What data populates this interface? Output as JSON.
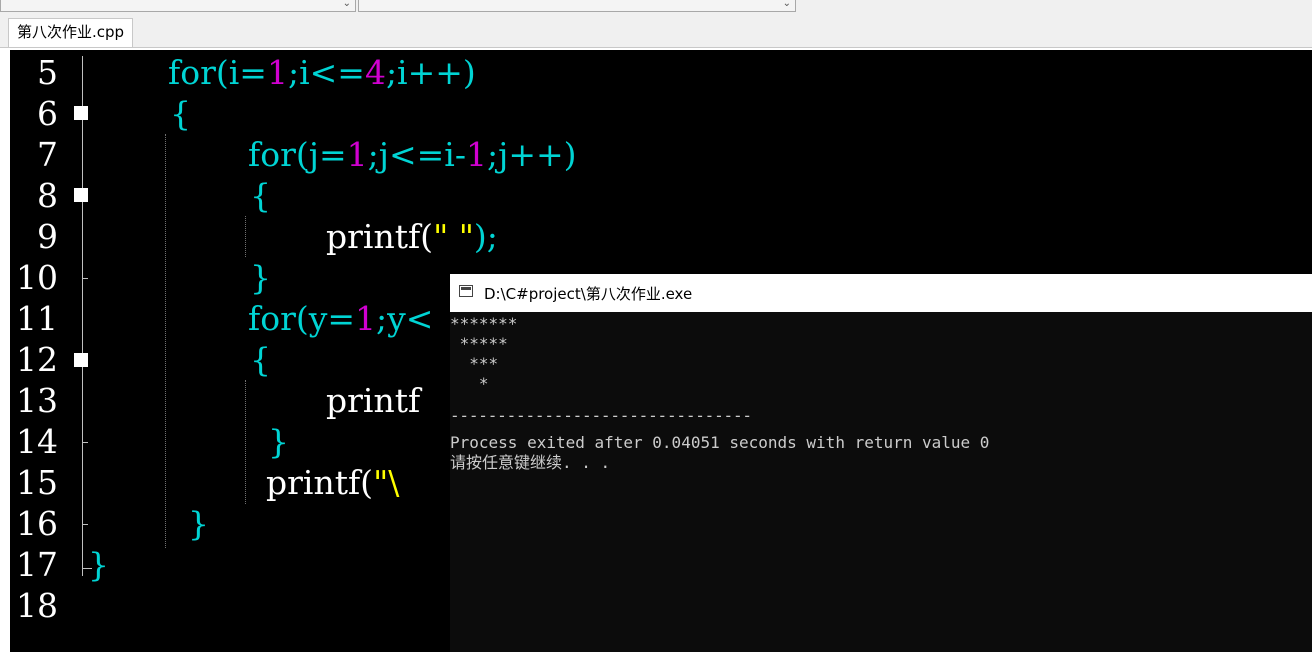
{
  "toolbar": {
    "combo1": "",
    "combo2": ""
  },
  "tab": {
    "label": "第八次作业.cpp"
  },
  "editor": {
    "line_numbers": [
      "5",
      "6",
      "7",
      "8",
      "9",
      "10",
      "11",
      "12",
      "13",
      "14",
      "15",
      "16",
      "17",
      "18"
    ],
    "lines": {
      "l5": {
        "kw": "for",
        "p1": "(i=",
        "n1": "1",
        "p2": ";i<=",
        "n2": "4",
        "p3": ";i++)"
      },
      "l6": {
        "brace": "{"
      },
      "l7": {
        "kw": "for",
        "p1": "(j=",
        "n1": "1",
        "p2": ";j<=i-",
        "n2": "1",
        "p3": ";j++)"
      },
      "l8": {
        "brace": "{"
      },
      "l9": {
        "fn": "printf(",
        "str": "\" \"",
        "end": ");"
      },
      "l10": {
        "brace": "}"
      },
      "l11": {
        "kw": "for",
        "p1": "(y=",
        "n1": "1",
        "p2": ";y<"
      },
      "l12": {
        "brace": "{"
      },
      "l13": {
        "fn": "printf"
      },
      "l14": {
        "brace": "}"
      },
      "l15": {
        "fn": "printf(",
        "str": "\"\\"
      },
      "l16": {
        "brace": "}"
      },
      "l17": {
        "brace": "}"
      }
    }
  },
  "console": {
    "title": "D:\\C#project\\第八次作业.exe",
    "output": [
      "*******",
      " *****",
      "  ***",
      "   *",
      "",
      "--------------------------------",
      "Process exited after 0.04051 seconds with return value 0",
      "请按任意键继续. . ."
    ]
  }
}
